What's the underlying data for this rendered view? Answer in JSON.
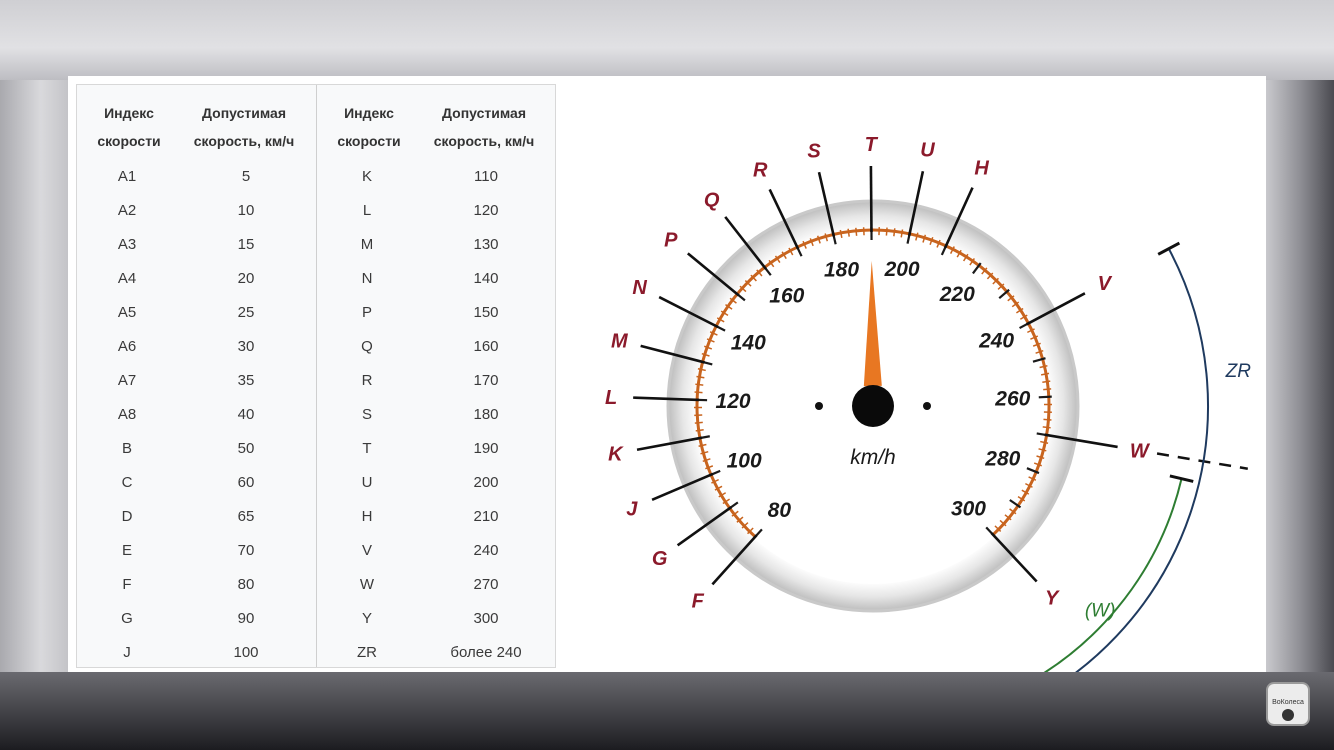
{
  "table": {
    "headers": {
      "index_line1": "Индекс",
      "index_line2": "скорости",
      "speed_line1": "Допустимая",
      "speed_line2": "скорость, км/ч"
    },
    "left_rows": [
      {
        "index": "A1",
        "speed": "5"
      },
      {
        "index": "A2",
        "speed": "10"
      },
      {
        "index": "A3",
        "speed": "15"
      },
      {
        "index": "A4",
        "speed": "20"
      },
      {
        "index": "A5",
        "speed": "25"
      },
      {
        "index": "A6",
        "speed": "30"
      },
      {
        "index": "A7",
        "speed": "35"
      },
      {
        "index": "A8",
        "speed": "40"
      },
      {
        "index": "B",
        "speed": "50"
      },
      {
        "index": "C",
        "speed": "60"
      },
      {
        "index": "D",
        "speed": "65"
      },
      {
        "index": "E",
        "speed": "70"
      },
      {
        "index": "F",
        "speed": "80"
      },
      {
        "index": "G",
        "speed": "90"
      },
      {
        "index": "J",
        "speed": "100"
      }
    ],
    "right_rows": [
      {
        "index": "K",
        "speed": "110"
      },
      {
        "index": "L",
        "speed": "120"
      },
      {
        "index": "M",
        "speed": "130"
      },
      {
        "index": "N",
        "speed": "140"
      },
      {
        "index": "P",
        "speed": "150"
      },
      {
        "index": "Q",
        "speed": "160"
      },
      {
        "index": "R",
        "speed": "170"
      },
      {
        "index": "S",
        "speed": "180"
      },
      {
        "index": "T",
        "speed": "190"
      },
      {
        "index": "U",
        "speed": "200"
      },
      {
        "index": "H",
        "speed": "210"
      },
      {
        "index": "V",
        "speed": "240"
      },
      {
        "index": "W",
        "speed": "270"
      },
      {
        "index": "Y",
        "speed": "300"
      },
      {
        "index": "ZR",
        "speed": "более 240"
      }
    ]
  },
  "gauge": {
    "unit_label": "km/h",
    "needle_value": 190,
    "min_value": 80,
    "max_value": 300,
    "scale_labels": [
      "80",
      "100",
      "120",
      "140",
      "160",
      "180",
      "200",
      "220",
      "240",
      "260",
      "280",
      "300"
    ],
    "letters": [
      {
        "letter": "F",
        "speed": 80
      },
      {
        "letter": "G",
        "speed": 90
      },
      {
        "letter": "J",
        "speed": 100
      },
      {
        "letter": "K",
        "speed": 110
      },
      {
        "letter": "L",
        "speed": 120
      },
      {
        "letter": "M",
        "speed": 130
      },
      {
        "letter": "N",
        "speed": 140
      },
      {
        "letter": "P",
        "speed": 150
      },
      {
        "letter": "Q",
        "speed": 160
      },
      {
        "letter": "R",
        "speed": 170
      },
      {
        "letter": "S",
        "speed": 180
      },
      {
        "letter": "T",
        "speed": 190
      },
      {
        "letter": "U",
        "speed": 200
      },
      {
        "letter": "H",
        "speed": 210
      },
      {
        "letter": "V",
        "speed": 240
      },
      {
        "letter": "W",
        "speed": 270
      },
      {
        "letter": "Y",
        "speed": 300
      }
    ],
    "range_labels": {
      "zr": "ZR",
      "w_paren": "(W)"
    },
    "colors": {
      "letter_color": "#8b1a2b",
      "tick_orange": "#c8641e",
      "needle": "#e87722",
      "zr_arc": "#1f3a5f",
      "w_arc": "#2e7d32"
    }
  },
  "watermark": {
    "text": "ВоКолеса"
  }
}
